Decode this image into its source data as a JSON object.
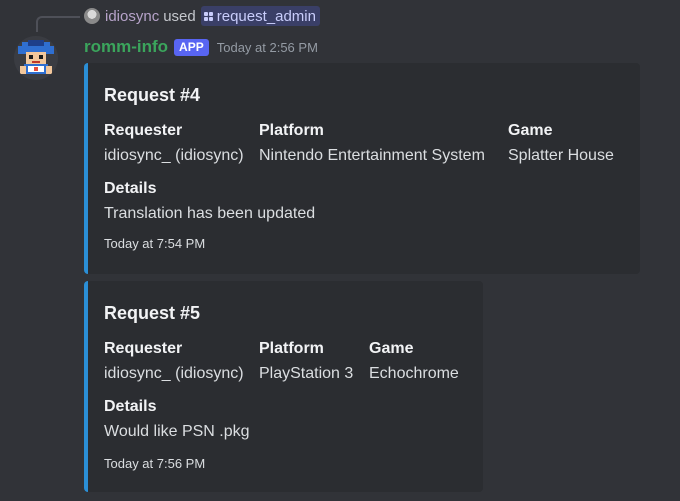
{
  "reply": {
    "username": "idiosync",
    "used_text": "used",
    "command": "request_admin"
  },
  "message": {
    "author": "romm-info",
    "tag": "APP",
    "timestamp": "Today at 2:56 PM"
  },
  "embeds": [
    {
      "title": "Request #4",
      "fields": [
        {
          "name": "Requester",
          "value": "idiosync_ (idiosync)"
        },
        {
          "name": "Platform",
          "value": "Nintendo Entertainment System"
        },
        {
          "name": "Game",
          "value": "Splatter House"
        },
        {
          "name": "Details",
          "value": "Translation has been updated"
        }
      ],
      "footer": "Today at 7:54 PM"
    },
    {
      "title": "Request #5",
      "fields": [
        {
          "name": "Requester",
          "value": "idiosync_ (idiosync)"
        },
        {
          "name": "Platform",
          "value": "PlayStation 3"
        },
        {
          "name": "Game",
          "value": "Echochrome"
        },
        {
          "name": "Details",
          "value": "Would like PSN .pkg"
        }
      ],
      "footer": "Today at 7:56 PM"
    }
  ],
  "colors": {
    "background": "#313338",
    "embed_background": "#2b2d31",
    "embed_accent": "#2b8fd6",
    "author": "#3ba55c",
    "app_tag": "#5865f2"
  }
}
